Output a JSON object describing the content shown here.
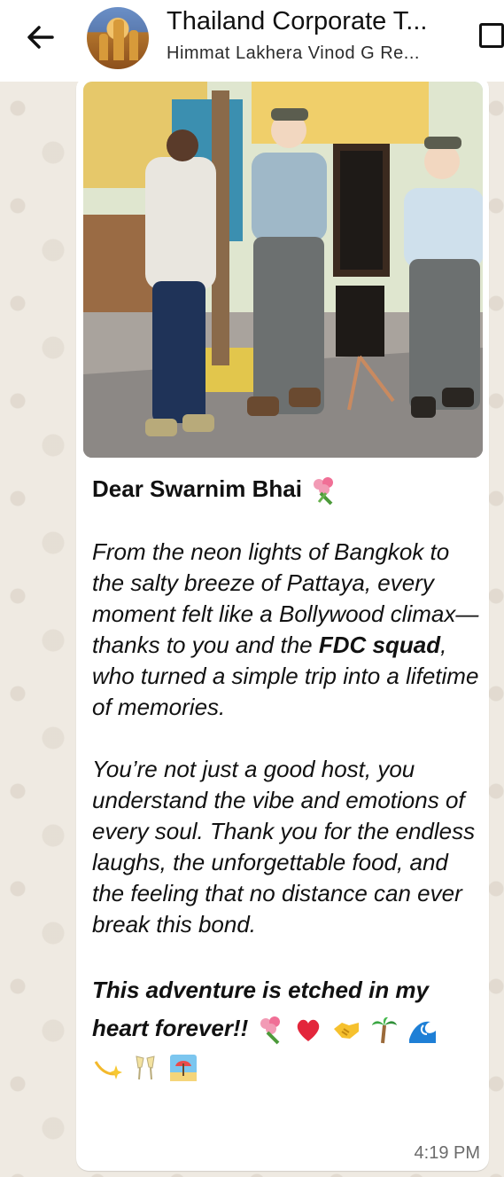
{
  "header": {
    "title": "Thailand Corporate T...",
    "subtitle": "Himmat Lakhera Vinod G Re..."
  },
  "icons": {
    "back": "arrow-left-icon",
    "menu": "square-icon"
  },
  "message": {
    "greeting": "Dear Swarnim Bhai",
    "p1_before": "From the neon lights of Bangkok to the salty breeze of Pattaya, every moment felt like a Bollywood climax—thanks to you and the ",
    "p1_bold": "FDC squad",
    "p1_after": ", who turned a simple trip into a lifetime of memories.",
    "p2": "You’re not just a good host, you understand the vibe and emotions of every soul. Thank you for the endless laughs, the unforgettable food, and the feeling that no distance can ever break this bond.",
    "closing": "This adventure is etched in my heart forever!!",
    "closing_emojis": [
      "bouquet",
      "heart",
      "handshake",
      "palm-tree",
      "wave",
      "shooting-star",
      "champagne-glasses",
      "beach-umbrella"
    ],
    "time": "4:19 PM"
  },
  "colors": {
    "background": "#efeae2",
    "bubble": "#ffffff",
    "header": "#ffffff"
  }
}
